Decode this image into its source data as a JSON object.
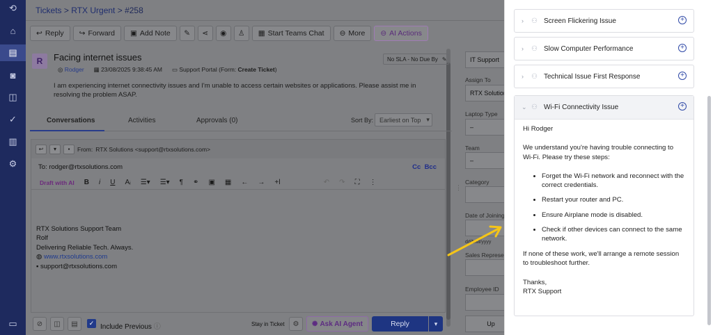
{
  "breadcrumb": {
    "tickets": "Tickets",
    "sep1": " > ",
    "queue": "RTX Urgent",
    "sep2": " > ",
    "ticket_id": "#258"
  },
  "toolbar": {
    "reply": "Reply",
    "forward": "Forward",
    "add_note": "Add Note",
    "teams": "Start Teams Chat",
    "more": "More",
    "ai_actions": "AI Actions"
  },
  "ticket": {
    "avatar": "R",
    "subject": "Facing internet issues",
    "requester": "Rodger",
    "created": "23/08/2025 9:38:45 AM",
    "source": "Support Portal",
    "form_prefix": "(Form: ",
    "form_name": "Create Ticket",
    "form_suffix": ")",
    "sla": "No SLA - No Due By",
    "description": "I am experiencing internet connectivity issues and I'm unable to access certain websites or applications. Please assist me in resolving the problem ASAP."
  },
  "tabs": {
    "conversations": "Conversations",
    "activities": "Activities",
    "approvals": "Approvals (0)"
  },
  "sort": {
    "label": "Sort By:",
    "value": "Earliest on Top"
  },
  "editor": {
    "from_label": "From:",
    "from_value": "RTX Solutions <support@rtxsolutions.com>",
    "to_label": "To:",
    "to_value": "rodger@rtxsolutions.com",
    "cc_bcc": "Cc  Bcc",
    "draft_ai": "Draft with AI",
    "signature": {
      "team": "RTX Solutions Support Team",
      "name": "Rolf",
      "tagline": "Delivering Reliable Tech. Always.",
      "website": "www.rtxsolutions.com",
      "email": "support@rtxsolutions.com"
    }
  },
  "footer": {
    "include_previous": "Include Previous",
    "stay_in_ticket": "Stay in Ticket",
    "ask_ai": "Ask AI Agent",
    "reply": "Reply"
  },
  "properties": {
    "group_value": "IT Support",
    "assign_to_label": "Assign To",
    "assign_to_value": "RTX Solution",
    "laptop_type_label": "Laptop Type",
    "laptop_type_value": "–",
    "team_label": "Team",
    "team_value": "–",
    "category_label": "Category",
    "date_joining_label": "Date of Joining",
    "date_format": "dd/MM/yyyy",
    "sales_rep_label": "Sales Represe",
    "employee_id_label": "Employee ID",
    "update_btn": "Up"
  },
  "kb_panel": {
    "articles": [
      {
        "title": "Screen Flickering Issue"
      },
      {
        "title": "Slow Computer Performance"
      },
      {
        "title": "Technical Issue First Response"
      }
    ],
    "open_article": {
      "title": "Wi-Fi Connectivity Issue",
      "greeting": "Hi Rodger",
      "intro": "We understand you're having trouble connecting to Wi-Fi. Please try these steps:",
      "steps": [
        "Forget the Wi-Fi network and reconnect with the correct credentials.",
        "Restart your router and PC.",
        "Ensure Airplane mode is disabled.",
        "Check if other devices can connect to the same network."
      ],
      "outro": "If none of these work, we'll arrange a remote session to troubleshoot further.",
      "closing": "Thanks,",
      "signoff": "RTX Support"
    }
  },
  "colors": {
    "nav": "#1e2a5e",
    "accent": "#2f49a7",
    "ai_purple": "#6c2a7c",
    "annotation_arrow": "#f5c518"
  }
}
